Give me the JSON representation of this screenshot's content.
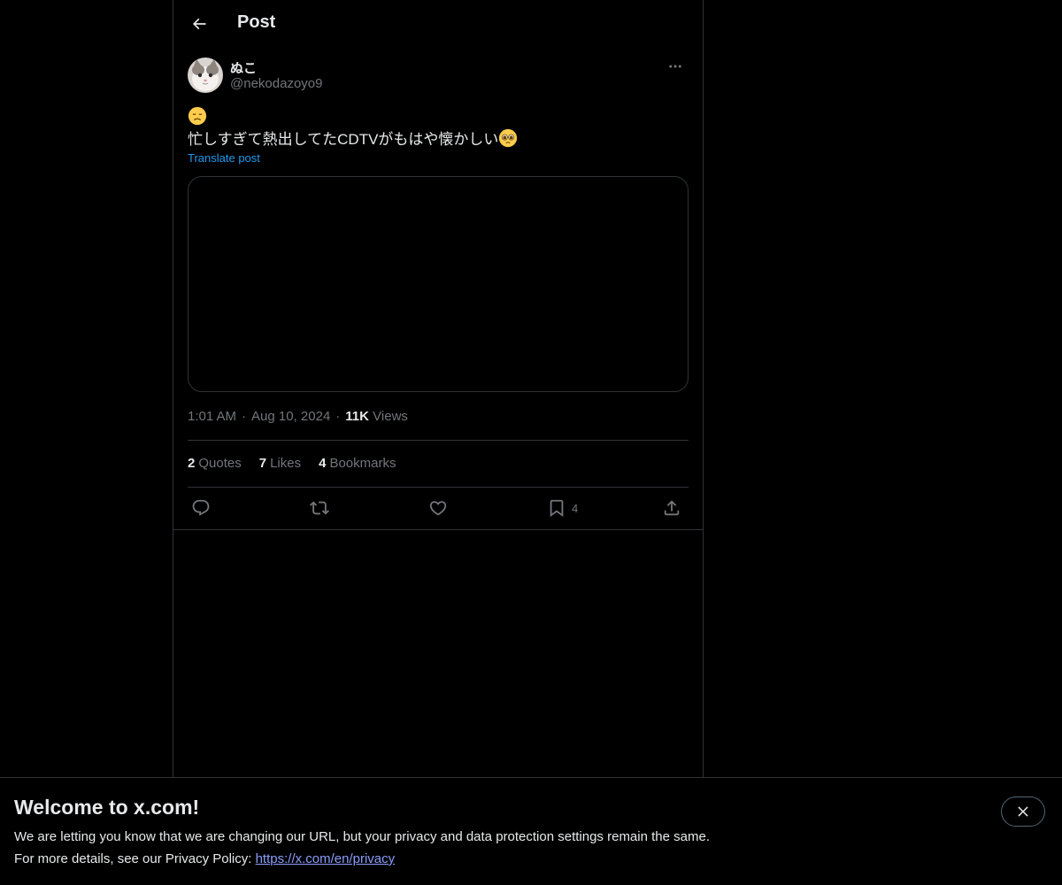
{
  "header": {
    "title": "Post",
    "back_icon": "arrow-left-icon"
  },
  "author": {
    "display_name": "ぬこ",
    "handle": "@nekodazoyo9",
    "more_icon": "more-horizontal-icon"
  },
  "post": {
    "emoji_line_icon": "disappointed-face-emoji",
    "text": "忙しすぎて熱出してたCDTVがもはや懐かしい",
    "trailing_emoji_icon": "pleading-face-emoji",
    "translate_label": "Translate post"
  },
  "meta": {
    "time": "1:01 AM",
    "date": "Aug 10, 2024",
    "views_count": "11K",
    "views_label": "Views",
    "separator": "·"
  },
  "stats": {
    "quotes_count": "2",
    "quotes_label": "Quotes",
    "likes_count": "7",
    "likes_label": "Likes",
    "bookmarks_count": "4",
    "bookmarks_label": "Bookmarks"
  },
  "actions": {
    "reply_icon": "reply-icon",
    "repost_icon": "repost-icon",
    "like_icon": "heart-icon",
    "bookmark_icon": "bookmark-icon",
    "bookmark_count": "4",
    "share_icon": "share-icon"
  },
  "banner": {
    "title": "Welcome to x.com!",
    "line1": "We are letting you know that we are changing our URL, but your privacy and data protection settings remain the same.",
    "line2_prefix": "For more details, see our Privacy Policy: ",
    "privacy_link": "https://x.com/en/privacy",
    "close_icon": "close-icon"
  },
  "colors": {
    "background": "#000000",
    "text_primary": "#e7e9ea",
    "text_secondary": "#71767b",
    "accent": "#1d9bf0",
    "border": "#2f3336",
    "link": "#8a9dfc"
  }
}
